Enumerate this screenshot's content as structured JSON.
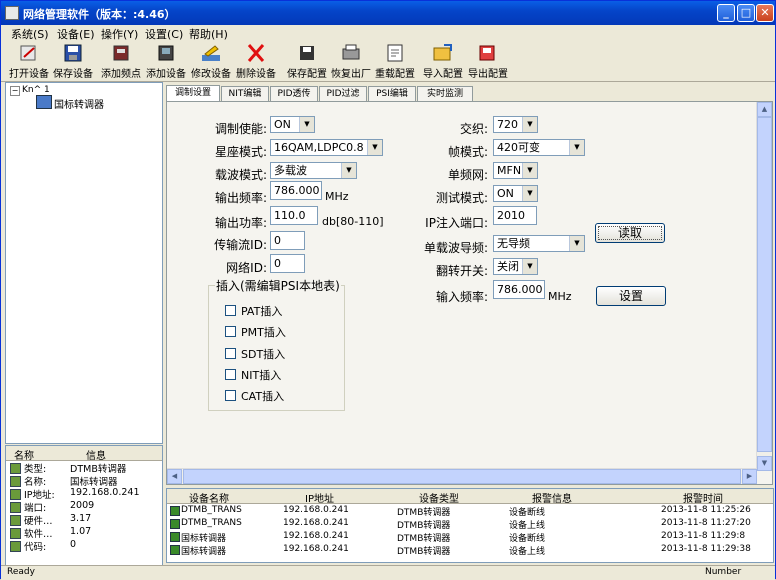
{
  "window": {
    "title": "网络管理软件（版本：:4.46）"
  },
  "menu": [
    "系统(S)",
    "设备(E)",
    "操作(Y)",
    "设置(C)",
    "帮助(H)"
  ],
  "toolbar": [
    "打开设备",
    "保存设备",
    "添加频点",
    "添加设备",
    "修改设备",
    "删除设备",
    "保存配置",
    "恢复出厂",
    "重载配置",
    "导入配置",
    "导出配置"
  ],
  "tree": {
    "root": "Kn^ 1",
    "child": "国标转调器"
  },
  "props": {
    "header": [
      "名称",
      "信息"
    ],
    "rows": [
      {
        "name": "类型:",
        "value": "DTMB转调器"
      },
      {
        "name": "名称:",
        "value": "国标转调器"
      },
      {
        "name": "IP地址:",
        "value": "192.168.0.241"
      },
      {
        "name": "端口:",
        "value": "2009"
      },
      {
        "name": "硬件…",
        "value": "3.17"
      },
      {
        "name": "软件…",
        "value": "1.07"
      },
      {
        "name": "代码:",
        "value": "0"
      }
    ]
  },
  "tabs": [
    "调制设置",
    "NIT编辑",
    "PID透传",
    "PID过滤",
    "PSI编辑",
    "实时监测"
  ],
  "form": {
    "mod_enable": {
      "label": "调制使能:",
      "value": "ON"
    },
    "constellation": {
      "label": "星座模式:",
      "value": "16QAM,LDPC0.8"
    },
    "carrier": {
      "label": "载波模式:",
      "value": "多载波"
    },
    "out_freq": {
      "label": "输出频率:",
      "value": "786.000",
      "unit": "MHz"
    },
    "out_power": {
      "label": "输出功率:",
      "value": "110.0",
      "unit": "db[80-110]"
    },
    "ts_id": {
      "label": "传输流ID:",
      "value": "0"
    },
    "net_id": {
      "label": "网络ID:",
      "value": "0"
    },
    "interleave": {
      "label": "交织:",
      "value": "720"
    },
    "frame": {
      "label": "帧模式:",
      "value": "420可变"
    },
    "sfn": {
      "label": "单频网:",
      "value": "MFN"
    },
    "test_mode": {
      "label": "测试模式:",
      "value": "ON"
    },
    "ip_port": {
      "label": "IP注入端口:",
      "value": "2010"
    },
    "pilot": {
      "label": "单载波导频:",
      "value": "无导频"
    },
    "flip": {
      "label": "翻转开关:",
      "value": "关闭"
    },
    "in_freq": {
      "label": "输入频率:",
      "value": "786.000",
      "unit": "MHz"
    },
    "read_btn": "读取",
    "set_btn": "设置",
    "group_title": "插入(需编辑PSI本地表)",
    "checks": [
      "PAT插入",
      "PMT插入",
      "SDT插入",
      "NIT插入",
      "CAT插入"
    ]
  },
  "log": {
    "headers": [
      "设备名称",
      "IP地址",
      "设备类型",
      "报警信息",
      "报警时间"
    ],
    "rows": [
      [
        "DTMB_TRANS",
        "192.168.0.241",
        "DTMB转调器",
        "设备断线",
        "2013-11-8 11:25:26"
      ],
      [
        "DTMB_TRANS",
        "192.168.0.241",
        "DTMB转调器",
        "设备上线",
        "2013-11-8 11:27:20"
      ],
      [
        "国标转调器",
        "192.168.0.241",
        "DTMB转调器",
        "设备断线",
        "2013-11-8 11:29:8"
      ],
      [
        "国标转调器",
        "192.168.0.241",
        "DTMB转调器",
        "设备上线",
        "2013-11-8 11:29:38"
      ]
    ]
  },
  "status": {
    "left": "Ready",
    "right": "Number"
  }
}
